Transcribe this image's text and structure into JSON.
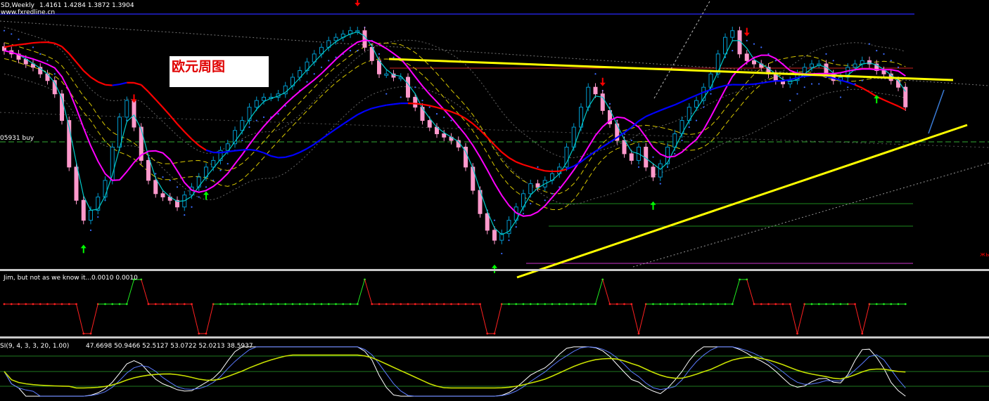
{
  "header": {
    "symbol": "SD,Weekly",
    "ohlc": "1.4161 1.4284 1.3872 1.3904",
    "site": "www.fxredline.cn"
  },
  "annotation": {
    "title": "欧元周图",
    "level_label": "05931 buy",
    "corner_mark": "жь"
  },
  "indicator1": {
    "name": "Jim, but not as we know it...",
    "values": "0.0010 0.0010"
  },
  "indicator2": {
    "name": "SI(9, 4, 3, 3, 20, 1.00)",
    "values": "47.6698 50.9466 52.5127 53.0722 52.0213 38.5937"
  },
  "colors": {
    "background": "#000000",
    "bull_candle": "#0099cc",
    "bear_candle": "#ff99cc",
    "support_trendline": "#ffff00",
    "long_ma_down": "#ff0000",
    "long_ma_up": "#0000ff",
    "medium_ma": "#ff00ff",
    "fast_ma": "#00cccc",
    "sell_arrow": "#ff0000",
    "buy_arrow": "#00ff00"
  },
  "chart_data": [
    {
      "type": "candlestick",
      "title": "SD,Weekly",
      "ohlc_last": {
        "open": 1.4161,
        "high": 1.4284,
        "low": 1.3872,
        "close": 1.3904
      },
      "candles": 126,
      "series": [
        {
          "name": "close",
          "values": [
            1.475,
            1.47,
            1.462,
            1.455,
            1.45,
            1.44,
            1.43,
            1.41,
            1.37,
            1.3,
            1.25,
            1.22,
            1.235,
            1.255,
            1.28,
            1.33,
            1.375,
            1.4,
            1.36,
            1.31,
            1.28,
            1.26,
            1.255,
            1.25,
            1.24,
            1.258,
            1.27,
            1.285,
            1.3,
            1.31,
            1.325,
            1.335,
            1.355,
            1.37,
            1.39,
            1.4,
            1.405,
            1.405,
            1.41,
            1.422,
            1.435,
            1.445,
            1.458,
            1.47,
            1.48,
            1.49,
            1.495,
            1.5,
            1.505,
            1.505,
            1.48,
            1.46,
            1.44,
            1.44,
            1.435,
            1.435,
            1.405,
            1.39,
            1.37,
            1.36,
            1.35,
            1.345,
            1.34,
            1.33,
            1.3,
            1.265,
            1.23,
            1.205,
            1.19,
            1.2,
            1.22,
            1.24,
            1.26,
            1.275,
            1.27,
            1.28,
            1.29,
            1.3,
            1.33,
            1.36,
            1.39,
            1.42,
            1.41,
            1.385,
            1.365,
            1.34,
            1.32,
            1.31,
            1.33,
            1.3,
            1.285,
            1.305,
            1.33,
            1.35,
            1.37,
            1.39,
            1.4,
            1.42,
            1.44,
            1.47,
            1.495,
            1.505,
            1.47,
            1.46,
            1.455,
            1.45,
            1.44,
            1.43,
            1.425,
            1.43,
            1.44,
            1.45,
            1.455,
            1.455,
            1.44,
            1.43,
            1.435,
            1.45,
            1.455,
            1.46,
            1.455,
            1.445,
            1.44,
            1.43,
            1.42,
            1.3904
          ]
        }
      ],
      "signals": [
        {
          "type": "sell",
          "index": 18
        },
        {
          "type": "buy",
          "index": 11
        },
        {
          "type": "buy",
          "index": 28
        },
        {
          "type": "sell",
          "index": 49
        },
        {
          "type": "buy",
          "index": 68
        },
        {
          "type": "sell",
          "index": 83
        },
        {
          "type": "buy",
          "index": 90
        },
        {
          "type": "sell",
          "index": 103
        },
        {
          "type": "buy",
          "index": 121
        }
      ]
    },
    {
      "type": "step",
      "title": "Jim, but not as we know it...",
      "series": [
        {
          "name": "signal",
          "values": [
            -1,
            -1,
            -1,
            -1,
            -1,
            -1,
            -1,
            -1,
            -1,
            -1,
            -1,
            -2,
            -2,
            -1,
            0,
            0,
            0,
            0,
            1,
            1,
            -1,
            -1,
            -1,
            -1,
            -1,
            -1,
            -1,
            -2,
            -2,
            -1,
            0,
            0,
            0,
            0,
            0,
            0,
            0,
            0,
            0,
            0,
            0,
            0,
            0,
            0,
            0,
            0,
            0,
            0,
            0,
            0,
            1,
            -1,
            -1,
            -1,
            -1,
            -1,
            -1,
            -1,
            -1,
            -1,
            -1,
            -1,
            -1,
            -1,
            -1,
            -1,
            -1,
            -2,
            -2,
            -1,
            0,
            0,
            0,
            0,
            0,
            0,
            0,
            0,
            0,
            0,
            0,
            0,
            0,
            1,
            -1,
            -1,
            -1,
            -1,
            -2,
            -1,
            0,
            0,
            0,
            0,
            0,
            0,
            0,
            0,
            0,
            0,
            0,
            0,
            1,
            1,
            -1,
            -1,
            -1,
            -1,
            -1,
            -1,
            -2,
            -1,
            0,
            0,
            0,
            0,
            0,
            0,
            -1,
            -2,
            -1,
            0,
            0,
            0,
            0,
            0
          ]
        }
      ]
    },
    {
      "type": "line",
      "title": "SI(9, 4, 3, 3, 20, 1.00)",
      "series": [
        {
          "name": "main",
          "values": [
            47.6698
          ]
        },
        {
          "name": "signal",
          "values": [
            50.9466
          ]
        }
      ]
    }
  ]
}
